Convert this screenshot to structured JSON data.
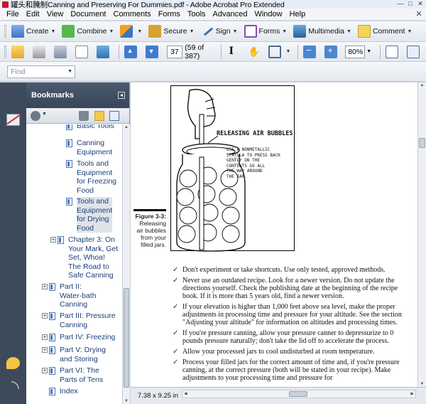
{
  "window": {
    "title": "罐头和腌制Canning and Preserving For Dummies.pdf - Adobe Acrobat Pro Extended",
    "controls": [
      "—",
      "□",
      "✕"
    ]
  },
  "menu": [
    "File",
    "Edit",
    "View",
    "Document",
    "Comments",
    "Forms",
    "Tools",
    "Advanced",
    "Window",
    "Help"
  ],
  "menu_close": "✕",
  "tasks_toolbar": {
    "create": "Create",
    "combine": "Combine",
    "secure": "Secure",
    "sign": "Sign",
    "forms": "Forms",
    "multimedia": "Multimedia",
    "comment": "Comment"
  },
  "nav_toolbar": {
    "page_number": "37",
    "page_count": "(59 of 387)",
    "zoom": "80%"
  },
  "find": {
    "placeholder": "Find"
  },
  "bookmarks": {
    "title": "Bookmarks",
    "items": [
      {
        "label": "Basic Tools",
        "lines": [
          "Basic Tools"
        ]
      },
      {
        "label": "Canning Equipment",
        "lines": [
          "Canning",
          "Equipment"
        ]
      },
      {
        "label": "Tools and Equipment for Freezing Food",
        "lines": [
          "Tools and",
          "Equipment",
          "for Freezing",
          "Food"
        ]
      },
      {
        "label": "Tools and Equipment for Drying Food",
        "lines": [
          "Tools and",
          "Equipment",
          "for Drying",
          "Food"
        ]
      },
      {
        "label": "Chapter 3: On Your Mark, Get Set, Whoa! The Road to Safe Canning",
        "lines": [
          "Chapter 3: On",
          "Your Mark, Get",
          "Set, Whoa!",
          "The Road to",
          "Safe Canning"
        ]
      },
      {
        "label": "Part II: Water-bath Canning",
        "lines": [
          "Part II:",
          "Water-bath",
          "Canning"
        ]
      },
      {
        "label": "Part III: Pressure Canning",
        "lines": [
          "Part III: Pressure",
          "Canning"
        ]
      },
      {
        "label": "Part IV: Freezing",
        "lines": [
          "Part IV: Freezing"
        ]
      },
      {
        "label": "Part V: Drying and Storing",
        "lines": [
          "Part V: Drying",
          "and Storing"
        ]
      },
      {
        "label": "Part VI: The Parts of Tens",
        "lines": [
          "Part VI: The",
          "Parts of Tens"
        ]
      },
      {
        "label": "Index",
        "lines": [
          "Index"
        ]
      }
    ]
  },
  "document": {
    "illustration_title": "RELEASING AIR BUBBLES",
    "illustration_note": [
      "USE A NONMETALLIC",
      "SPATULA TO PRESS BACK",
      "GENTLY ON THE",
      "CONTENTS GO ALL",
      "THE WAY AROUND",
      "THE JAR."
    ],
    "figure_label": "Figure 3-3:",
    "figure_caption": [
      "Releasing",
      "air bubbles",
      "from your",
      "filled jars."
    ],
    "bullets": [
      "Don't experiment or take shortcuts. Use only tested, approved methods.",
      "Never use an outdated recipe. Look for a newer version. Do not update the directions yourself. Check the publishing date at the beginning of the recipe book. If it is more than 5 years old, find a newer version.",
      "If your elevation is higher than 1,000 feet above sea level, make the proper adjustments in processing time and pressure for your altitude. See the section \"Adjusting your altitude\" for information on altitudes and processing times.",
      "If you're pressure canning, allow your pressure canner to depressurize to 0 pounds pressure naturally; don't take the lid off to accelerate the process.",
      "Allow your processed jars to cool undisturbed at room temperature.",
      "Process your filled jars for the correct amount of time and, if you're pressure canning, at the correct pressure (both will be stated in your recipe). Make adjustments to your processing time and pressure for"
    ]
  },
  "status": {
    "page_size": "7.38 x 9.25 in"
  }
}
